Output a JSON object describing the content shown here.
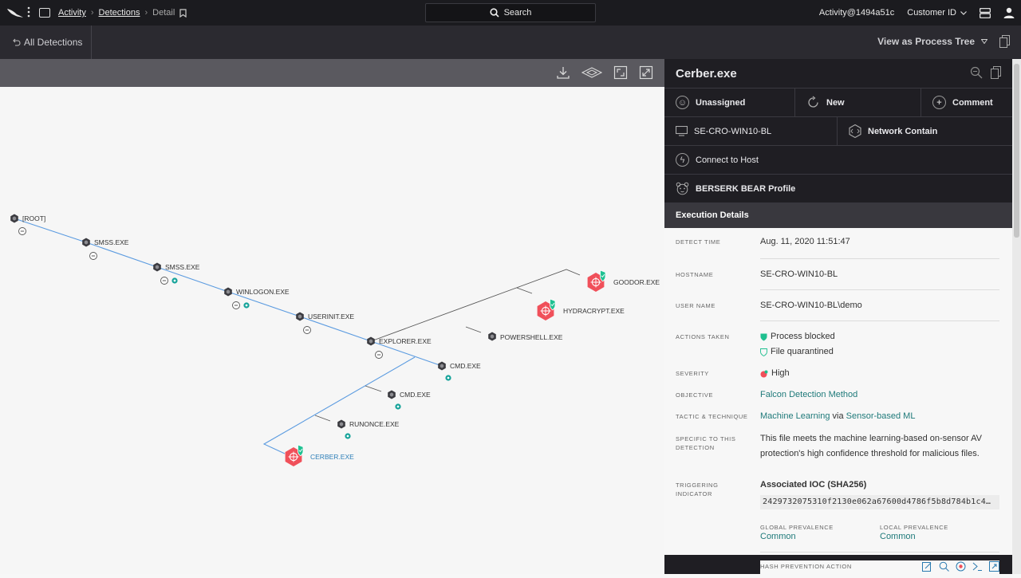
{
  "topbar": {
    "breadcrumb": [
      "Activity",
      "Detections",
      "Detail"
    ],
    "search_label": "Search",
    "user": "Activity@1494a51c",
    "customer_id": "Customer ID"
  },
  "secbar": {
    "back_label": "All Detections",
    "view_as": "View as Process Tree"
  },
  "tree": {
    "nodes": [
      {
        "label": "[ROOT]",
        "type": "normal"
      },
      {
        "label": "SMSS.EXE",
        "type": "normal"
      },
      {
        "label": "SMSS.EXE",
        "type": "normal"
      },
      {
        "label": "WINLOGON.EXE",
        "type": "normal"
      },
      {
        "label": "USERINIT.EXE",
        "type": "normal"
      },
      {
        "label": "EXPLORER.EXE",
        "type": "normal"
      },
      {
        "label": "CMD.EXE",
        "type": "normal"
      },
      {
        "label": "CMD.EXE",
        "type": "normal"
      },
      {
        "label": "RUNONCE.EXE",
        "type": "normal"
      },
      {
        "label": "CERBER.EXE",
        "type": "detection"
      },
      {
        "label": "POWERSHELL.EXE",
        "type": "normal"
      },
      {
        "label": "HYDRACRYPT.EXE",
        "type": "detection"
      },
      {
        "label": "GOODOR.EXE",
        "type": "detection"
      }
    ]
  },
  "panel": {
    "title": "Cerber.exe",
    "assign": "Unassigned",
    "status": "New",
    "comment": "Comment",
    "host": "SE-CRO-WIN10-BL",
    "network_contain": "Network Contain",
    "connect": "Connect to Host",
    "profile": "BERSERK BEAR Profile",
    "exec_title": "Execution Details",
    "detect_time_label": "DETECT TIME",
    "detect_time": "Aug. 11, 2020 11:51:47",
    "hostname_label": "HOSTNAME",
    "hostname": "SE-CRO-WIN10-BL",
    "username_label": "USER NAME",
    "username": "SE-CRO-WIN10-BL\\demo",
    "actions_label": "ACTIONS TAKEN",
    "action1": "Process blocked",
    "action2": "File quarantined",
    "severity_label": "SEVERITY",
    "severity": "High",
    "objective_label": "OBJECTIVE",
    "objective": "Falcon Detection Method",
    "tactic_label": "TACTIC & TECHNIQUE",
    "tactic": "Machine Learning",
    "tactic_via": "via",
    "technique": "Sensor-based ML",
    "specific_label1": "SPECIFIC TO THIS",
    "specific_label2": "DETECTION",
    "specific_line1": "This file meets the machine learning-based on-sensor AV",
    "specific_line2": "protection's high confidence threshold for malicious files.",
    "trig_label1": "TRIGGERING",
    "trig_label2": "INDICATOR",
    "ioc_title": "Associated IOC (SHA256)",
    "hash": "2429732075310f2130e062a67600d4786f5b8d784b1c4…",
    "global_prev_label": "GLOBAL PREVALENCE",
    "global_prev": "Common",
    "local_prev_label": "LOCAL PREVALENCE",
    "local_prev": "Common",
    "hash_prev_label": "HASH PREVENTION ACTION"
  },
  "colors": {
    "accent_teal": "#1f7a7a",
    "detection_red": "#f0505a",
    "shield_green": "#1fbf8f",
    "tree_line": "#4a90e2"
  }
}
